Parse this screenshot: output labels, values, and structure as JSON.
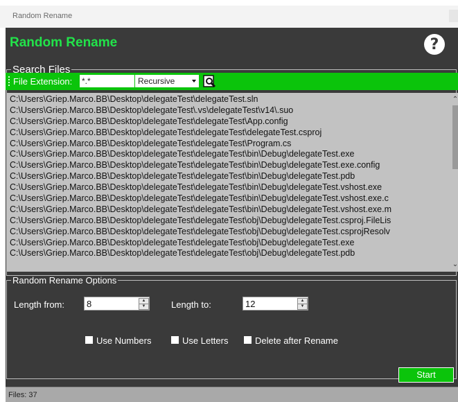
{
  "window": {
    "title": "Random Rename"
  },
  "header": {
    "title": "Random Rename",
    "help_icon": "help-question-icon"
  },
  "search": {
    "group_title": "Search Files",
    "extension_label": "File Extension:",
    "extension_value": "*.*",
    "mode_value": "Recursive",
    "search_icon": "magnifier-icon",
    "files": [
      "C:\\Users\\Griep.Marco.BB\\Desktop\\delegateTest\\delegateTest.sln",
      "C:\\Users\\Griep.Marco.BB\\Desktop\\delegateTest\\.vs\\delegateTest\\v14\\.suo",
      "C:\\Users\\Griep.Marco.BB\\Desktop\\delegateTest\\delegateTest\\App.config",
      "C:\\Users\\Griep.Marco.BB\\Desktop\\delegateTest\\delegateTest\\delegateTest.csproj",
      "C:\\Users\\Griep.Marco.BB\\Desktop\\delegateTest\\delegateTest\\Program.cs",
      "C:\\Users\\Griep.Marco.BB\\Desktop\\delegateTest\\delegateTest\\bin\\Debug\\delegateTest.exe",
      "C:\\Users\\Griep.Marco.BB\\Desktop\\delegateTest\\delegateTest\\bin\\Debug\\delegateTest.exe.config",
      "C:\\Users\\Griep.Marco.BB\\Desktop\\delegateTest\\delegateTest\\bin\\Debug\\delegateTest.pdb",
      "C:\\Users\\Griep.Marco.BB\\Desktop\\delegateTest\\delegateTest\\bin\\Debug\\delegateTest.vshost.exe",
      "C:\\Users\\Griep.Marco.BB\\Desktop\\delegateTest\\delegateTest\\bin\\Debug\\delegateTest.vshost.exe.c",
      "C:\\Users\\Griep.Marco.BB\\Desktop\\delegateTest\\delegateTest\\bin\\Debug\\delegateTest.vshost.exe.m",
      "C:\\Users\\Griep.Marco.BB\\Desktop\\delegateTest\\delegateTest\\obj\\Debug\\delegateTest.csproj.FileLis",
      "C:\\Users\\Griep.Marco.BB\\Desktop\\delegateTest\\delegateTest\\obj\\Debug\\delegateTest.csprojResolv",
      "C:\\Users\\Griep.Marco.BB\\Desktop\\delegateTest\\delegateTest\\obj\\Debug\\delegateTest.exe",
      "C:\\Users\\Griep.Marco.BB\\Desktop\\delegateTest\\delegateTest\\obj\\Debug\\delegateTest.pdb"
    ]
  },
  "options": {
    "group_title": "Random Rename Options",
    "length_from_label": "Length from:",
    "length_from_value": "8",
    "length_to_label": "Length to:",
    "length_to_value": "12",
    "use_numbers_label": "Use Numbers",
    "use_letters_label": "Use Letters",
    "delete_after_label": "Delete after Rename",
    "start_label": "Start"
  },
  "status": {
    "files_text": "Files: 37"
  },
  "colors": {
    "accent": "#0bc40b",
    "title_green": "#22e34a",
    "panel": "#3a3a3a"
  }
}
